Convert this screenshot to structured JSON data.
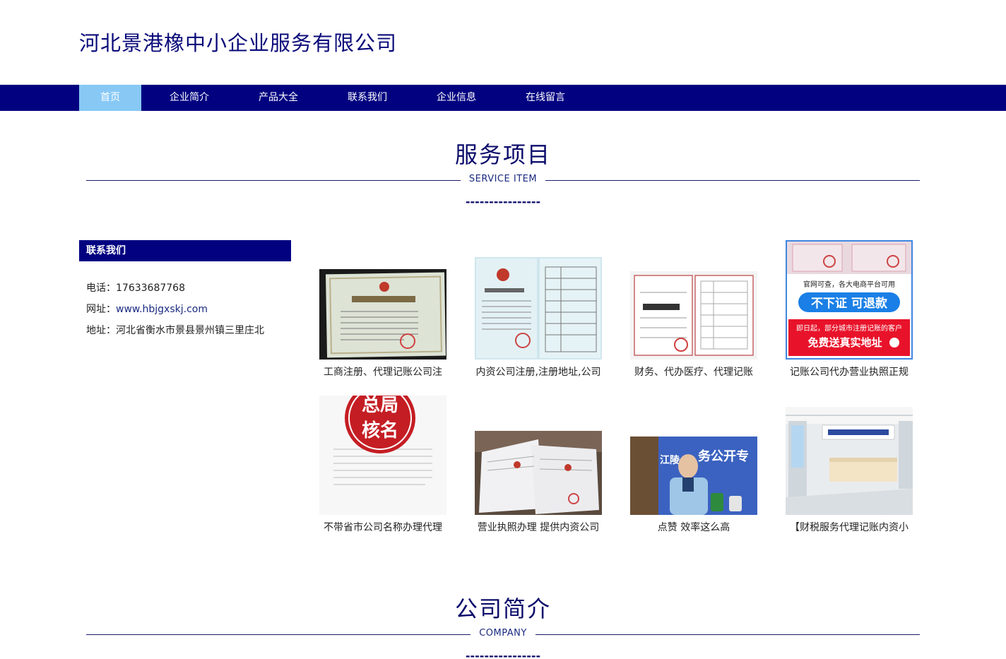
{
  "header": {
    "title": "河北景港橡中小企业服务有限公司"
  },
  "nav": {
    "items": [
      {
        "label": "首页",
        "active": true
      },
      {
        "label": "企业简介"
      },
      {
        "label": "产品大全"
      },
      {
        "label": "联系我们"
      },
      {
        "label": "企业信息"
      },
      {
        "label": "在线留言"
      }
    ]
  },
  "services": {
    "title": "服务项目",
    "subtitle": "SERVICE ITEM",
    "dashes": "----------------"
  },
  "sidebar": {
    "heading": "联系我们",
    "phone_label": "电话：",
    "phone": "17633687768",
    "site_label": "网址：",
    "site": "www.hbjgxskj.com",
    "address_label": "地址：",
    "address": "河北省衡水市景县景州镇三里庄北"
  },
  "products": [
    {
      "caption": "工商注册、代理记账公司注"
    },
    {
      "caption": "内资公司注册,注册地址,公司"
    },
    {
      "caption": "财务、代办医疗、代理记账"
    },
    {
      "caption": "记账公司代办营业执照正规",
      "banner_line1": "官网可查，各大电商平台可用",
      "banner_line2": "不下证 可退款",
      "banner_line3": "即日起，部分城市注册记账的客户",
      "banner_line4": "免费送真实地址"
    },
    {
      "caption": "不带省市公司名称办理代理",
      "stamp_text_1": "总局",
      "stamp_text_2": "核名"
    },
    {
      "caption": "营业执照办理 提供内资公司"
    },
    {
      "caption": "点赞 效率这么高",
      "tv_text": "江陵",
      "tv_text_2": "务公开专"
    },
    {
      "caption": "【财税服务代理记账内资小"
    }
  ],
  "company": {
    "title": "公司简介",
    "subtitle": "COMPANY",
    "dashes": "----------------"
  },
  "colors": {
    "nav_bg": "#020281",
    "nav_active": "#87c8f5",
    "title": "#0a0a7a"
  }
}
